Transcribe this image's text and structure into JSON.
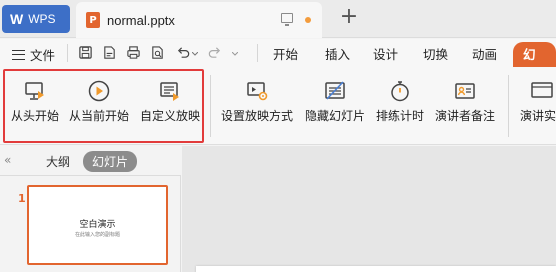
{
  "titlebar": {
    "app_tab": {
      "logo": "W",
      "label": "WPS"
    },
    "doc_tab": {
      "icon": "P",
      "name": "normal.pptx"
    },
    "add_tab": "+"
  },
  "menubar": {
    "file_label": "文件",
    "tabs": [
      "开始",
      "插入",
      "设计",
      "切换",
      "动画",
      "幻灯片"
    ],
    "active_tab": "幻灯片"
  },
  "ribbon": {
    "buttons": [
      {
        "label": "从头开始",
        "icon": "play-from-start-icon"
      },
      {
        "label": "从当前开始",
        "icon": "play-from-current-icon"
      },
      {
        "label": "自定义放映",
        "icon": "custom-show-icon"
      },
      {
        "label": "设置放映方式",
        "icon": "slideshow-settings-icon"
      },
      {
        "label": "隐藏幻灯片",
        "icon": "hide-slide-icon"
      },
      {
        "label": "排练计时",
        "icon": "rehearse-timer-icon"
      },
      {
        "label": "演讲者备注",
        "icon": "speaker-notes-icon"
      },
      {
        "label": "演讲实",
        "icon": "presenter-view-icon"
      }
    ]
  },
  "panel": {
    "collapse": "«",
    "tabs": [
      "大纲",
      "幻灯片"
    ],
    "active_tab": "幻灯片",
    "slides": [
      {
        "number": "1",
        "title": "空白演示",
        "subtitle": "在此输入您的副标题"
      }
    ]
  },
  "colors": {
    "accent": "#e2652f",
    "wps_blue": "#3d6fc7",
    "highlight": "#e23b3b"
  }
}
